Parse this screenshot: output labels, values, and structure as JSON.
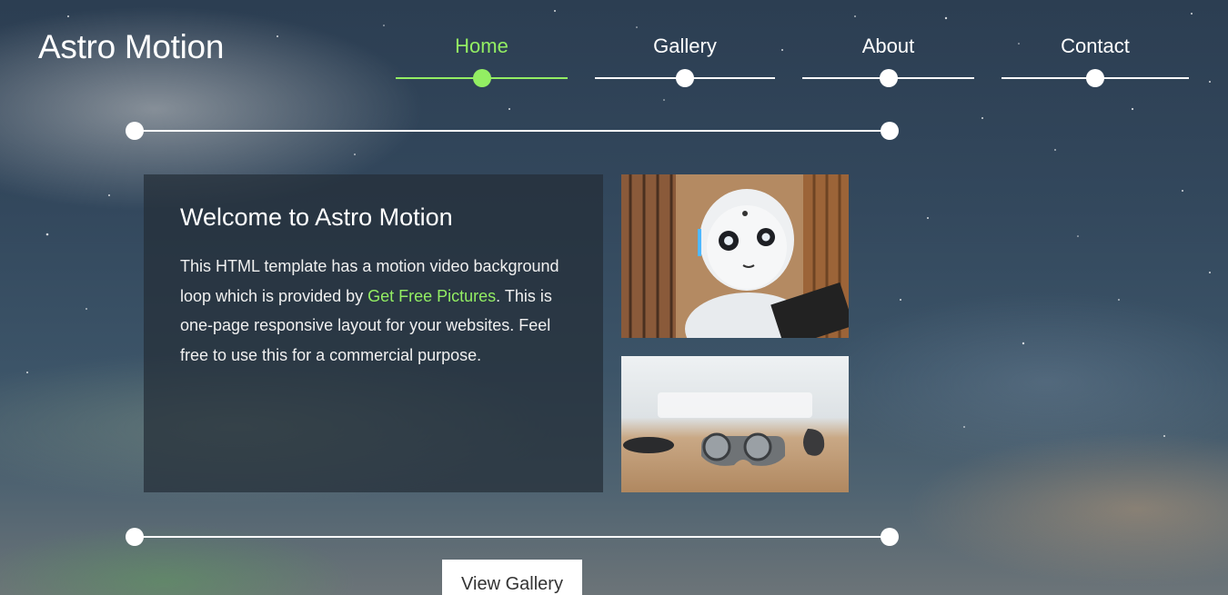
{
  "brand": {
    "title": "Astro Motion"
  },
  "nav": {
    "items": [
      {
        "label": "Home",
        "active": true
      },
      {
        "label": "Gallery",
        "active": false
      },
      {
        "label": "About",
        "active": false
      },
      {
        "label": "Contact",
        "active": false
      }
    ]
  },
  "welcome": {
    "heading": "Welcome to Astro Motion",
    "text_before_link": "This HTML template has a motion video background loop which is provided by ",
    "link_text": "Get Free Pictures",
    "text_after_link": ". This is one-page responsive layout for your websites. Feel free to use this for a commercial purpose."
  },
  "images": [
    {
      "icon": "robot-photo"
    },
    {
      "icon": "vr-glasses-photo"
    }
  ],
  "actions": {
    "view_gallery_label": "View Gallery"
  },
  "colors": {
    "accent": "#93ee63",
    "panel": "#242e38",
    "white": "#ffffff"
  }
}
